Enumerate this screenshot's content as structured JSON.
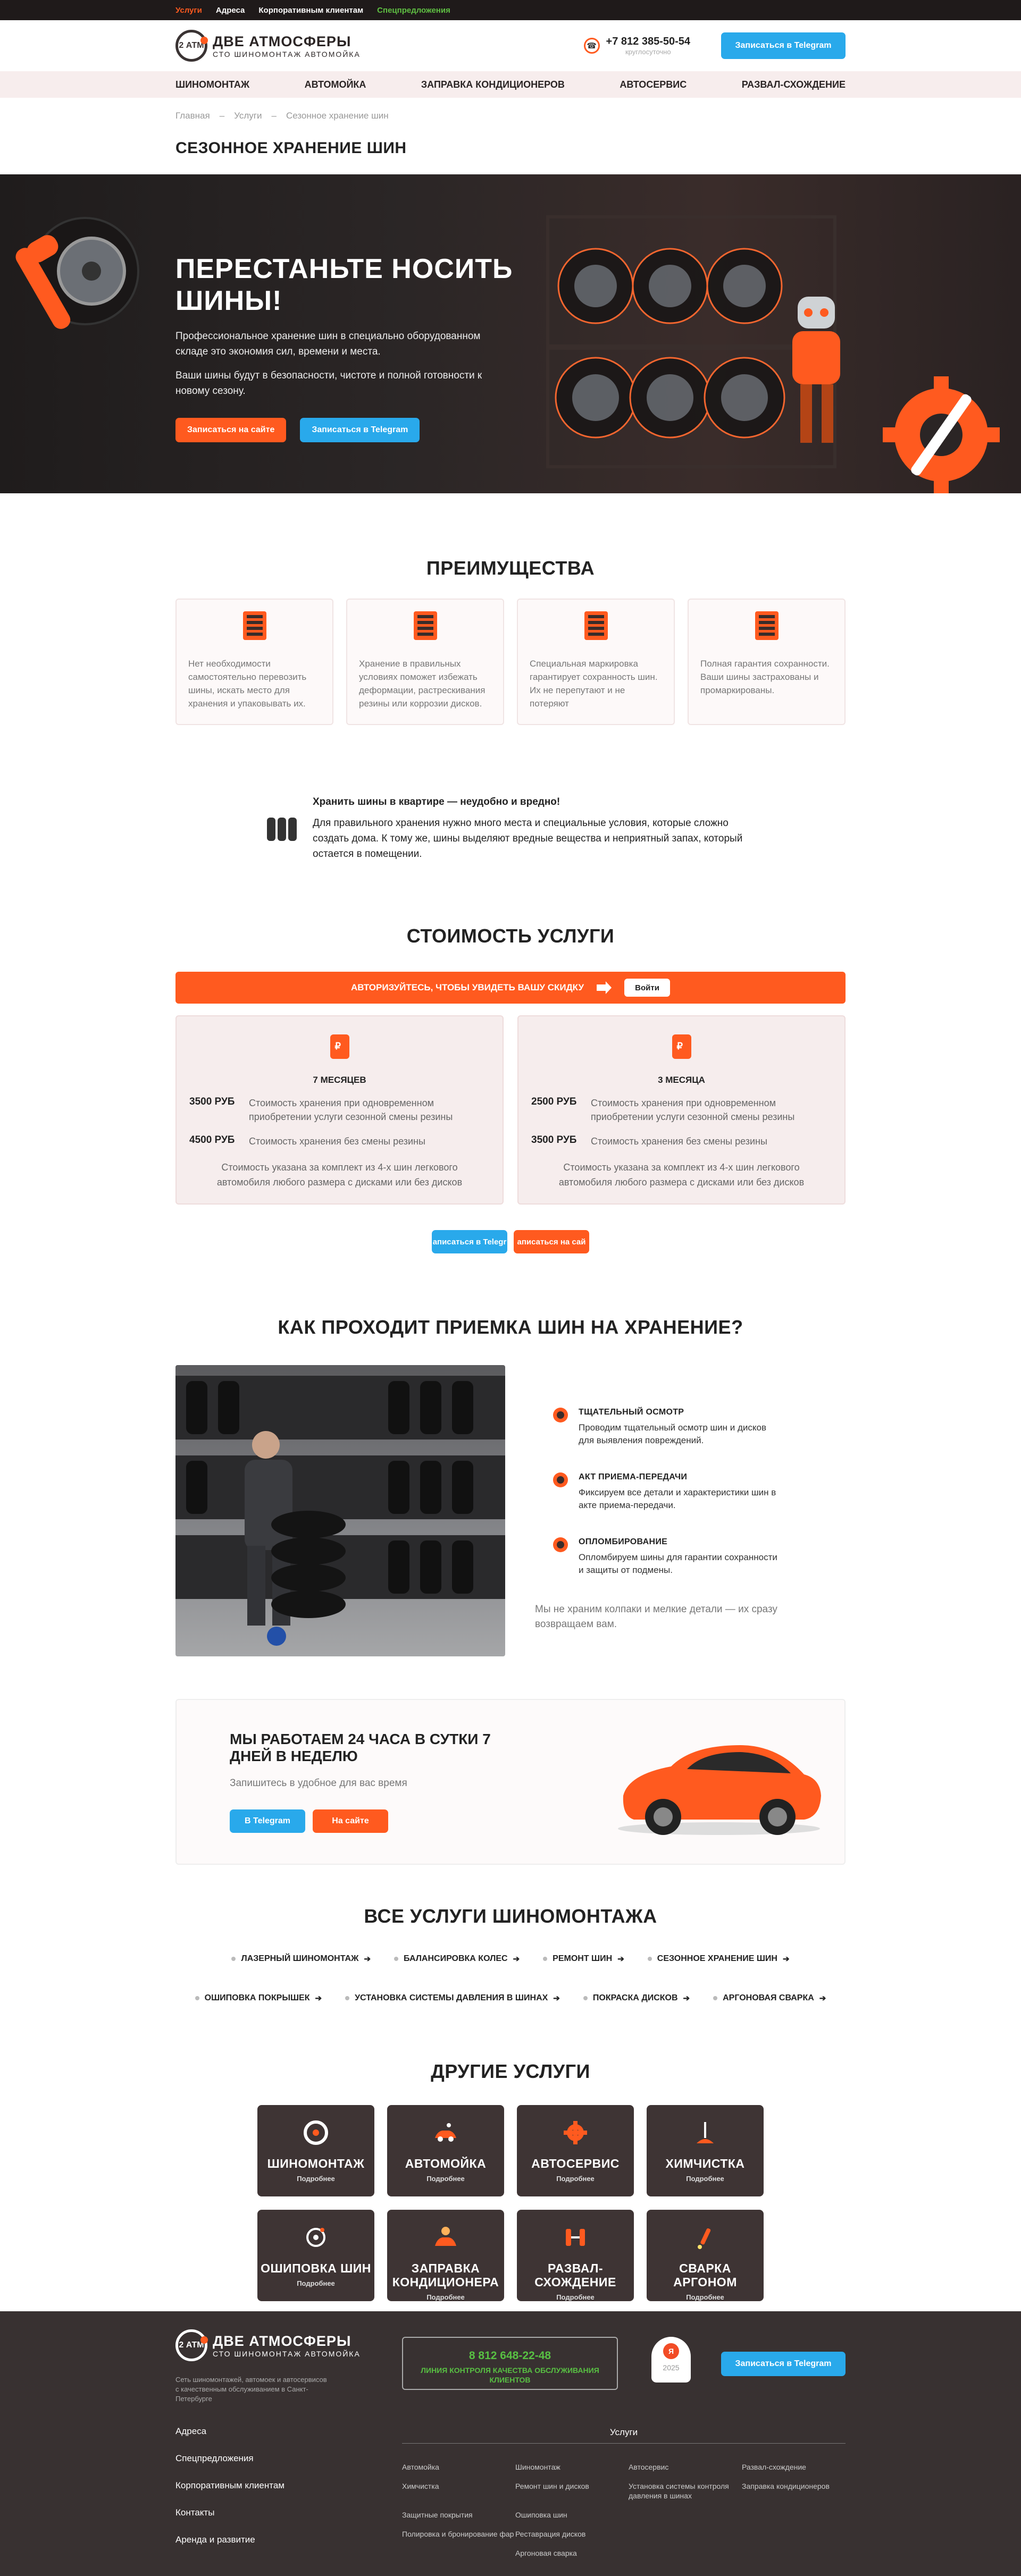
{
  "topbar": {
    "links": [
      "Услуги",
      "Адреса",
      "Корпоративным клиентам",
      "Спецпредложения"
    ]
  },
  "header": {
    "logo_mark": "2 АТМ",
    "logo_title": "ДВЕ АТМОСФЕРЫ",
    "logo_sub": "СТО  ШИНОМОНТАЖ  АВТОМОЙКА",
    "phone": "+7 812 385-50-54",
    "phone_note": "круглосуточно",
    "telegram_btn": "Записаться в Telegram"
  },
  "nav": [
    "ШИНОМОНТАЖ",
    "АВТОМОЙКА",
    "ЗАПРАВКА КОНДИЦИОНЕРОВ",
    "АВТОСЕРВИС",
    "РАЗВАЛ-СХОЖДЕНИЕ"
  ],
  "breadcrumbs": [
    "Главная",
    "–",
    "Услуги",
    "–",
    "Сезонное хранение шин"
  ],
  "page_title": "СЕЗОННОЕ ХРАНЕНИЕ ШИН",
  "hero": {
    "title": "ПЕРЕСТАНЬТЕ НОСИТЬ ШИНЫ!",
    "p1": "Профессиональное хранение шин в специально оборудованном складе это экономия сил, времени и места.",
    "p2": "Ваши шины будут в безопасности, чистоте и полной готовности к новому сезону.",
    "btn_site": "Записаться на сайте",
    "btn_tg": "Записаться в Telegram"
  },
  "advantages": {
    "title": "ПРЕИМУЩЕСТВА",
    "items": [
      "Нет необходимости самостоятельно перевозить шины, искать место для хранения и упаковывать их.",
      "Хранение в правильных условиях поможет избежать деформации, растрескивания резины или коррозии дисков.",
      "Специальная маркировка гарантирует сохранность шин. Их не перепутают и не потеряют",
      "Полная гарантия сохранности. Ваши шины застрахованы и промаркированы."
    ]
  },
  "note": {
    "title": "Хранить шины в квартире — неудобно и вредно!",
    "text": "Для правильного хранения нужно много места и специальные условия, которые сложно создать дома. К тому же, шины выделяют вредные вещества и неприятный запах, который остается в помещении."
  },
  "pricing": {
    "title": "СТОИМОСТЬ УСЛУГИ",
    "auth_text": "АВТОРИЗУЙТЕСЬ, ЧТОБЫ УВИДЕТЬ ВАШУ СКИДКУ",
    "login_btn": "Войти",
    "cards": [
      {
        "period": "7 МЕСЯЦЕВ",
        "price1": "3500 РУБ",
        "desc1": "Стоимость хранения при одновременном приобретении услуги сезонной смены резины",
        "price2": "4500 РУБ",
        "desc2": "Стоимость хранения без смены резины",
        "fine": "Стоимость указана за комплект из 4-х шин легкового автомобиля любого размера с дисками или без дисков"
      },
      {
        "period": "3 МЕСЯЦА",
        "price1": "2500 РУБ",
        "desc1": "Стоимость хранения при одновременном приобретении услуги сезонной смены резины",
        "price2": "3500 РУБ",
        "desc2": "Стоимость хранения без смены резины",
        "fine": "Стоимость указана за комплект из 4-х шин легкового автомобиля любого размера с дисками или без дисков"
      }
    ],
    "btn_tg": "аписаться в Telegr",
    "btn_site": "аписаться на сай"
  },
  "process": {
    "title": "КАК ПРОХОДИТ ПРИЕМКА ШИН НА ХРАНЕНИЕ?",
    "steps": [
      {
        "title": "ТЩАТЕЛЬНЫЙ ОСМОТР",
        "text": "Проводим тщательный осмотр шин и дисков для выявления повреждений."
      },
      {
        "title": "АКТ ПРИЕМА-ПЕРЕДАЧИ",
        "text": "Фиксируем все детали и характеристики шин в акте приема-передачи."
      },
      {
        "title": "ОПЛОМБИРОВАНИЕ",
        "text": "Опломбируем шины для гарантии сохранности и защиты от подмены."
      }
    ],
    "tail": "Мы не храним колпаки и мелкие детали — их сразу возвращаем вам."
  },
  "work": {
    "title": "МЫ РАБОТАЕМ 24 ЧАСА В СУТКИ 7 ДНЕЙ В НЕДЕЛЮ",
    "text": "Запишитесь в удобное для вас время",
    "btn_tg": "В Telegram",
    "btn_site": "На сайте"
  },
  "all_services": {
    "title": "ВСЕ УСЛУГИ ШИНОМОНТАЖА",
    "row1": [
      "ЛАЗЕРНЫЙ ШИНОМОНТАЖ",
      "БАЛАНСИРОВКА КОЛЕС",
      "РЕМОНТ ШИН",
      "СЕЗОННОЕ ХРАНЕНИЕ ШИН"
    ],
    "row2": [
      "ОШИПОВКА ПОКРЫШЕК",
      "УСТАНОВКА СИСТЕМЫ ДАВЛЕНИЯ В ШИНАХ",
      "ПОКРАСКА ДИСКОВ",
      "АРГОНОВАЯ СВАРКА"
    ]
  },
  "other_services": {
    "title": "ДРУГИЕ УСЛУГИ",
    "more": "Подробнее",
    "tiles": [
      "ШИНОМОНТАЖ",
      "АВТОМОЙКА",
      "АВТОСЕРВИС",
      "ХИМЧИСТКА",
      "ОШИПОВКА ШИН",
      "ЗАПРАВКА КОНДИЦИОНЕРА",
      "РАЗВАЛ-СХОЖДЕНИЕ",
      "СВАРКА АРГОНОМ"
    ]
  },
  "footer": {
    "desc": "Сеть шиномонтажей, автомоек и автосервисов с качественным обслуживанием в Санкт-Петербурге",
    "hotline_phone": "8 812 648-22-48",
    "hotline_text": "ЛИНИЯ КОНТРОЛЯ КАЧЕСТВА ОБСЛУЖИВАНИЯ КЛИЕНТОВ",
    "badge_year": "2025",
    "telegram_btn": "Записаться в Telegram",
    "left_links": [
      "Адреса",
      "Спецпредложения",
      "Корпоративным клиентам",
      "Контакты",
      "Аренда и развитие"
    ],
    "services_title": "Услуги",
    "services": [
      "Автомойка",
      "Шиномонтаж",
      "Автосервис",
      "Развал-схождение",
      "Химчистка",
      "Ремонт шин и дисков",
      "Установка системы контроля давления в шинах",
      "Заправка кондиционеров",
      "Защитные покрытия",
      "Ошиповка шин",
      "",
      "",
      "Полировка и бронирование фар",
      "Реставрация дисков",
      "",
      "",
      "",
      "Аргоновая сварка",
      "",
      ""
    ]
  },
  "colors": {
    "accent": "#ff5a1f",
    "telegram": "#29a9eb",
    "dark": "#383131",
    "green": "#58c043"
  }
}
